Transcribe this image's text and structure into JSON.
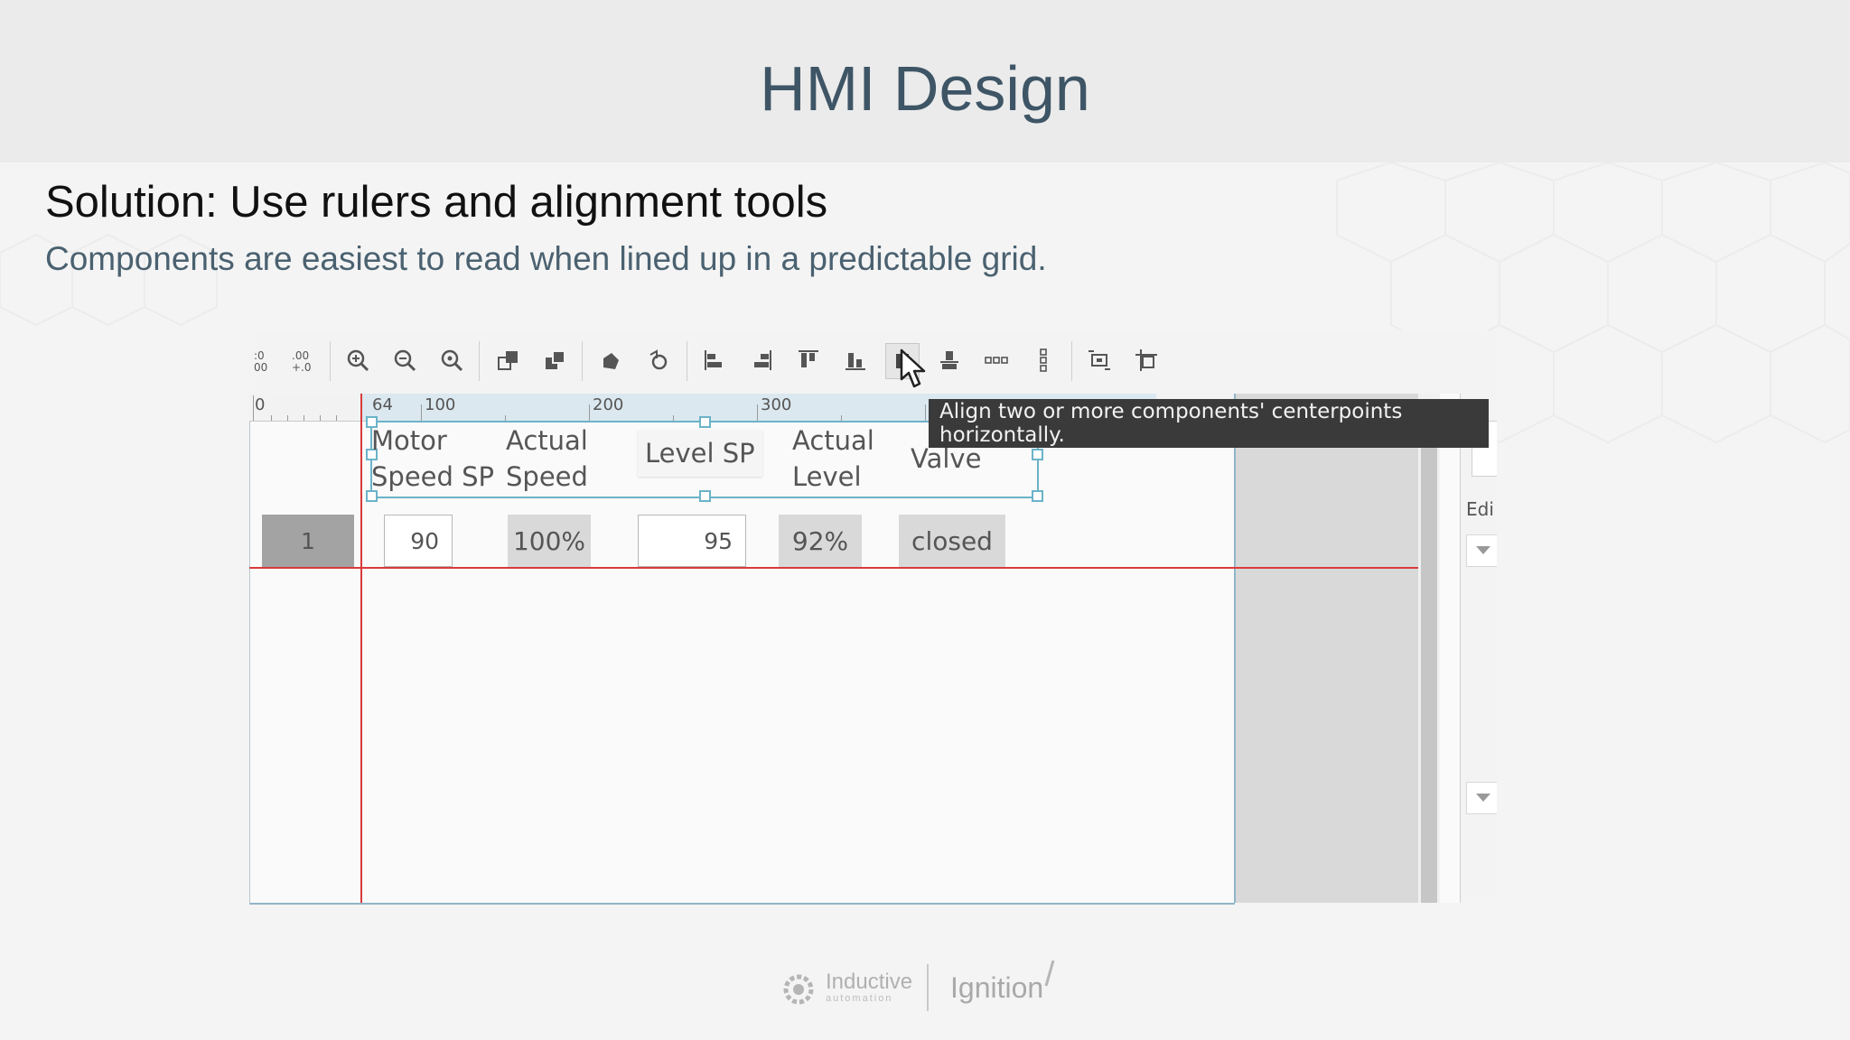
{
  "slide": {
    "title": "HMI Design",
    "solution_title": "Solution: Use rulers and alignment tools",
    "solution_subtitle": "Components are easiest to read when lined up in a predictable grid."
  },
  "toolbar": {
    "icons": [
      "snap-to-grid-icon",
      "snap-to-grid-alt-icon",
      "zoom-in-icon",
      "zoom-out-icon",
      "zoom-fit-icon",
      "bring-forward-icon",
      "send-backward-icon",
      "group-icon",
      "ungroup-icon",
      "align-left-icon",
      "align-right-icon",
      "align-top-icon",
      "align-bottom-icon",
      "align-center-horizontal-icon",
      "align-center-vertical-icon",
      "distribute-horizontal-icon",
      "distribute-vertical-icon",
      "same-size-icon",
      "same-width-icon"
    ],
    "tooltip": "Align two or more components' centerpoints horizontally."
  },
  "ruler": {
    "labels": [
      "0",
      "64",
      "100",
      "200",
      "300"
    ]
  },
  "headers": {
    "motor_speed_sp": [
      "Motor",
      "Speed SP"
    ],
    "actual_speed": [
      "Actual",
      "Speed"
    ],
    "level_sp": "Level SP",
    "actual_level": [
      "Actual",
      "Level"
    ],
    "valve": "Valve"
  },
  "row": {
    "index": "1",
    "motor_speed_sp": "90",
    "actual_speed": "100%",
    "level_sp": "95",
    "actual_level": "92%",
    "valve": "closed"
  },
  "right_panel": {
    "edit_label": "Edi"
  },
  "footer": {
    "brand1": "Inductive",
    "brand1_sub": "automation",
    "brand2": "Ignition"
  },
  "colors": {
    "title": "#3e5566",
    "guide": "#d93b3b",
    "selection": "#6bb3c8"
  }
}
